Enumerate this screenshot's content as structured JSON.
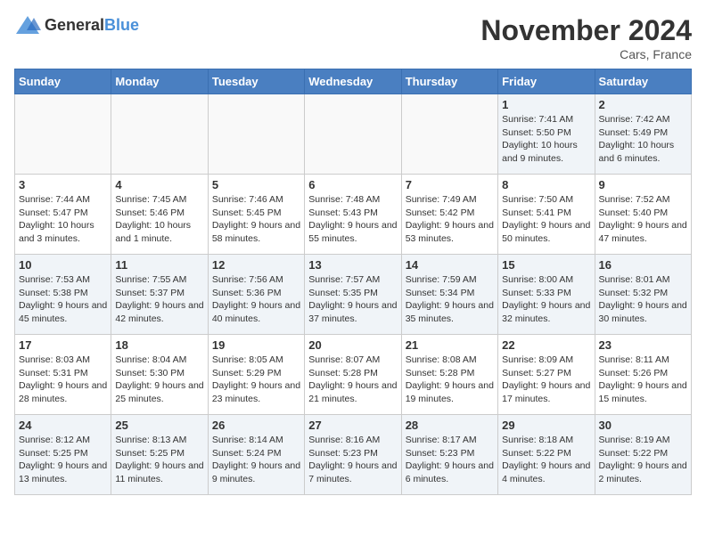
{
  "header": {
    "logo_general": "General",
    "logo_blue": "Blue",
    "month_title": "November 2024",
    "location": "Cars, France"
  },
  "weekdays": [
    "Sunday",
    "Monday",
    "Tuesday",
    "Wednesday",
    "Thursday",
    "Friday",
    "Saturday"
  ],
  "weeks": [
    [
      {
        "day": "",
        "info": "",
        "empty": true
      },
      {
        "day": "",
        "info": "",
        "empty": true
      },
      {
        "day": "",
        "info": "",
        "empty": true
      },
      {
        "day": "",
        "info": "",
        "empty": true
      },
      {
        "day": "",
        "info": "",
        "empty": true
      },
      {
        "day": "1",
        "info": "Sunrise: 7:41 AM\nSunset: 5:50 PM\nDaylight: 10 hours and 9 minutes."
      },
      {
        "day": "2",
        "info": "Sunrise: 7:42 AM\nSunset: 5:49 PM\nDaylight: 10 hours and 6 minutes."
      }
    ],
    [
      {
        "day": "3",
        "info": "Sunrise: 7:44 AM\nSunset: 5:47 PM\nDaylight: 10 hours and 3 minutes."
      },
      {
        "day": "4",
        "info": "Sunrise: 7:45 AM\nSunset: 5:46 PM\nDaylight: 10 hours and 1 minute."
      },
      {
        "day": "5",
        "info": "Sunrise: 7:46 AM\nSunset: 5:45 PM\nDaylight: 9 hours and 58 minutes."
      },
      {
        "day": "6",
        "info": "Sunrise: 7:48 AM\nSunset: 5:43 PM\nDaylight: 9 hours and 55 minutes."
      },
      {
        "day": "7",
        "info": "Sunrise: 7:49 AM\nSunset: 5:42 PM\nDaylight: 9 hours and 53 minutes."
      },
      {
        "day": "8",
        "info": "Sunrise: 7:50 AM\nSunset: 5:41 PM\nDaylight: 9 hours and 50 minutes."
      },
      {
        "day": "9",
        "info": "Sunrise: 7:52 AM\nSunset: 5:40 PM\nDaylight: 9 hours and 47 minutes."
      }
    ],
    [
      {
        "day": "10",
        "info": "Sunrise: 7:53 AM\nSunset: 5:38 PM\nDaylight: 9 hours and 45 minutes."
      },
      {
        "day": "11",
        "info": "Sunrise: 7:55 AM\nSunset: 5:37 PM\nDaylight: 9 hours and 42 minutes."
      },
      {
        "day": "12",
        "info": "Sunrise: 7:56 AM\nSunset: 5:36 PM\nDaylight: 9 hours and 40 minutes."
      },
      {
        "day": "13",
        "info": "Sunrise: 7:57 AM\nSunset: 5:35 PM\nDaylight: 9 hours and 37 minutes."
      },
      {
        "day": "14",
        "info": "Sunrise: 7:59 AM\nSunset: 5:34 PM\nDaylight: 9 hours and 35 minutes."
      },
      {
        "day": "15",
        "info": "Sunrise: 8:00 AM\nSunset: 5:33 PM\nDaylight: 9 hours and 32 minutes."
      },
      {
        "day": "16",
        "info": "Sunrise: 8:01 AM\nSunset: 5:32 PM\nDaylight: 9 hours and 30 minutes."
      }
    ],
    [
      {
        "day": "17",
        "info": "Sunrise: 8:03 AM\nSunset: 5:31 PM\nDaylight: 9 hours and 28 minutes."
      },
      {
        "day": "18",
        "info": "Sunrise: 8:04 AM\nSunset: 5:30 PM\nDaylight: 9 hours and 25 minutes."
      },
      {
        "day": "19",
        "info": "Sunrise: 8:05 AM\nSunset: 5:29 PM\nDaylight: 9 hours and 23 minutes."
      },
      {
        "day": "20",
        "info": "Sunrise: 8:07 AM\nSunset: 5:28 PM\nDaylight: 9 hours and 21 minutes."
      },
      {
        "day": "21",
        "info": "Sunrise: 8:08 AM\nSunset: 5:28 PM\nDaylight: 9 hours and 19 minutes."
      },
      {
        "day": "22",
        "info": "Sunrise: 8:09 AM\nSunset: 5:27 PM\nDaylight: 9 hours and 17 minutes."
      },
      {
        "day": "23",
        "info": "Sunrise: 8:11 AM\nSunset: 5:26 PM\nDaylight: 9 hours and 15 minutes."
      }
    ],
    [
      {
        "day": "24",
        "info": "Sunrise: 8:12 AM\nSunset: 5:25 PM\nDaylight: 9 hours and 13 minutes."
      },
      {
        "day": "25",
        "info": "Sunrise: 8:13 AM\nSunset: 5:25 PM\nDaylight: 9 hours and 11 minutes."
      },
      {
        "day": "26",
        "info": "Sunrise: 8:14 AM\nSunset: 5:24 PM\nDaylight: 9 hours and 9 minutes."
      },
      {
        "day": "27",
        "info": "Sunrise: 8:16 AM\nSunset: 5:23 PM\nDaylight: 9 hours and 7 minutes."
      },
      {
        "day": "28",
        "info": "Sunrise: 8:17 AM\nSunset: 5:23 PM\nDaylight: 9 hours and 6 minutes."
      },
      {
        "day": "29",
        "info": "Sunrise: 8:18 AM\nSunset: 5:22 PM\nDaylight: 9 hours and 4 minutes."
      },
      {
        "day": "30",
        "info": "Sunrise: 8:19 AM\nSunset: 5:22 PM\nDaylight: 9 hours and 2 minutes."
      }
    ]
  ]
}
